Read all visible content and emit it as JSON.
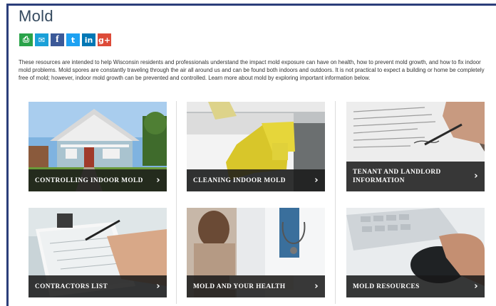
{
  "page": {
    "title": "Mold",
    "intro": "These resources are intended to help Wisconsin residents and professionals understand the impact mold exposure can have on health, how to prevent mold growth, and how to fix indoor mold problems. Mold spores are constantly traveling through the air all around us and can be found both indoors and outdoors. It is not practical to expect a building or home be completely free of mold; however, indoor mold growth can be prevented and controlled. Learn more about mold by exploring important information below."
  },
  "share": [
    {
      "icon": "print-icon",
      "glyph": "⎙"
    },
    {
      "icon": "email-icon",
      "glyph": "✉"
    },
    {
      "icon": "facebook-icon",
      "glyph": "f"
    },
    {
      "icon": "twitter-icon",
      "glyph": "t"
    },
    {
      "icon": "linkedin-icon",
      "glyph": "in"
    },
    {
      "icon": "google-plus-icon",
      "glyph": "g+"
    }
  ],
  "cards": [
    {
      "label": "CONTROLLING INDOOR MOLD",
      "chevron": "›"
    },
    {
      "label": "CLEANING INDOOR MOLD",
      "chevron": "›"
    },
    {
      "label": "TENANT AND LANDLORD INFORMATION",
      "chevron": "›"
    },
    {
      "label": "CONTRACTORS LIST",
      "chevron": "›"
    },
    {
      "label": "MOLD AND YOUR HEALTH",
      "chevron": "›"
    },
    {
      "label": "MOLD RESOURCES",
      "chevron": "›"
    }
  ],
  "colors": {
    "accent": "#2b3e7a",
    "title": "#34495e",
    "caption_bg": "#191919"
  }
}
